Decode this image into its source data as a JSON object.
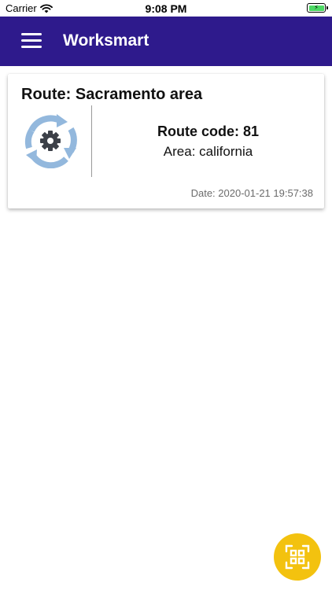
{
  "status_bar": {
    "carrier": "Carrier",
    "time": "9:08 PM",
    "battery_color": "#4cd964"
  },
  "header": {
    "title": "Worksmart",
    "menu_icon": "hamburger-menu-icon",
    "background_color": "#2e1a8c"
  },
  "route_card": {
    "title": "Route: Sacramento area",
    "icon": "gear-refresh-icon",
    "code": "Route code: 81",
    "area": "Area: california",
    "date": "Date: 2020-01-21 19:57:38"
  },
  "fab": {
    "icon": "qr-scan-icon",
    "color": "#f3c20f"
  }
}
